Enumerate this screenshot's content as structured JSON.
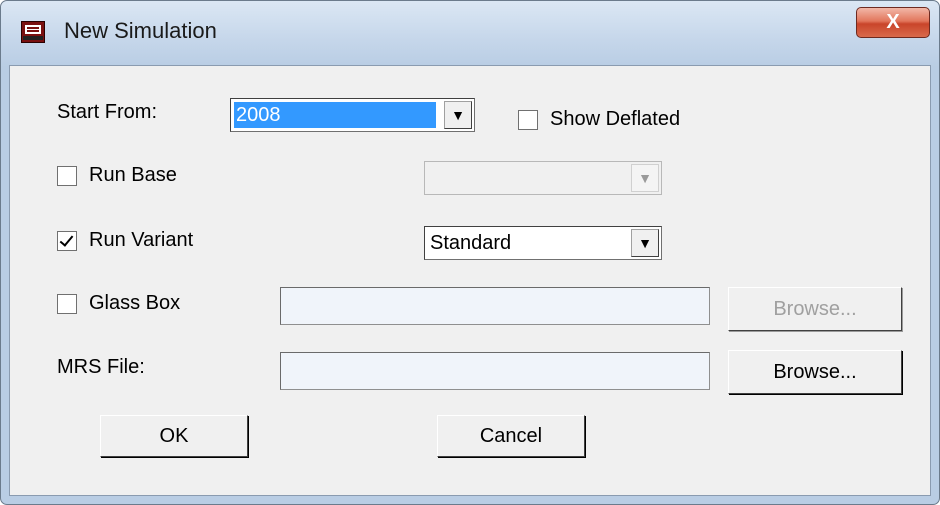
{
  "window": {
    "title": "New Simulation",
    "close_label": "X"
  },
  "form": {
    "start_from": {
      "label": "Start From:",
      "value": "2008"
    },
    "show_deflated": {
      "label": "Show Deflated",
      "checked": false
    },
    "run_base": {
      "label": "Run Base",
      "checked": false,
      "value": "",
      "enabled": false
    },
    "run_variant": {
      "label": "Run Variant",
      "checked": true,
      "value": "Standard"
    },
    "glass_box": {
      "label": "Glass Box",
      "checked": false,
      "path": "",
      "browse_label": "Browse...",
      "browse_enabled": false
    },
    "mrs_file": {
      "label": "MRS File:",
      "path": "",
      "browse_label": "Browse..."
    },
    "ok_label": "OK",
    "cancel_label": "Cancel"
  },
  "icons": {
    "app": "application-icon",
    "dropdown": "chevron-down-icon"
  }
}
